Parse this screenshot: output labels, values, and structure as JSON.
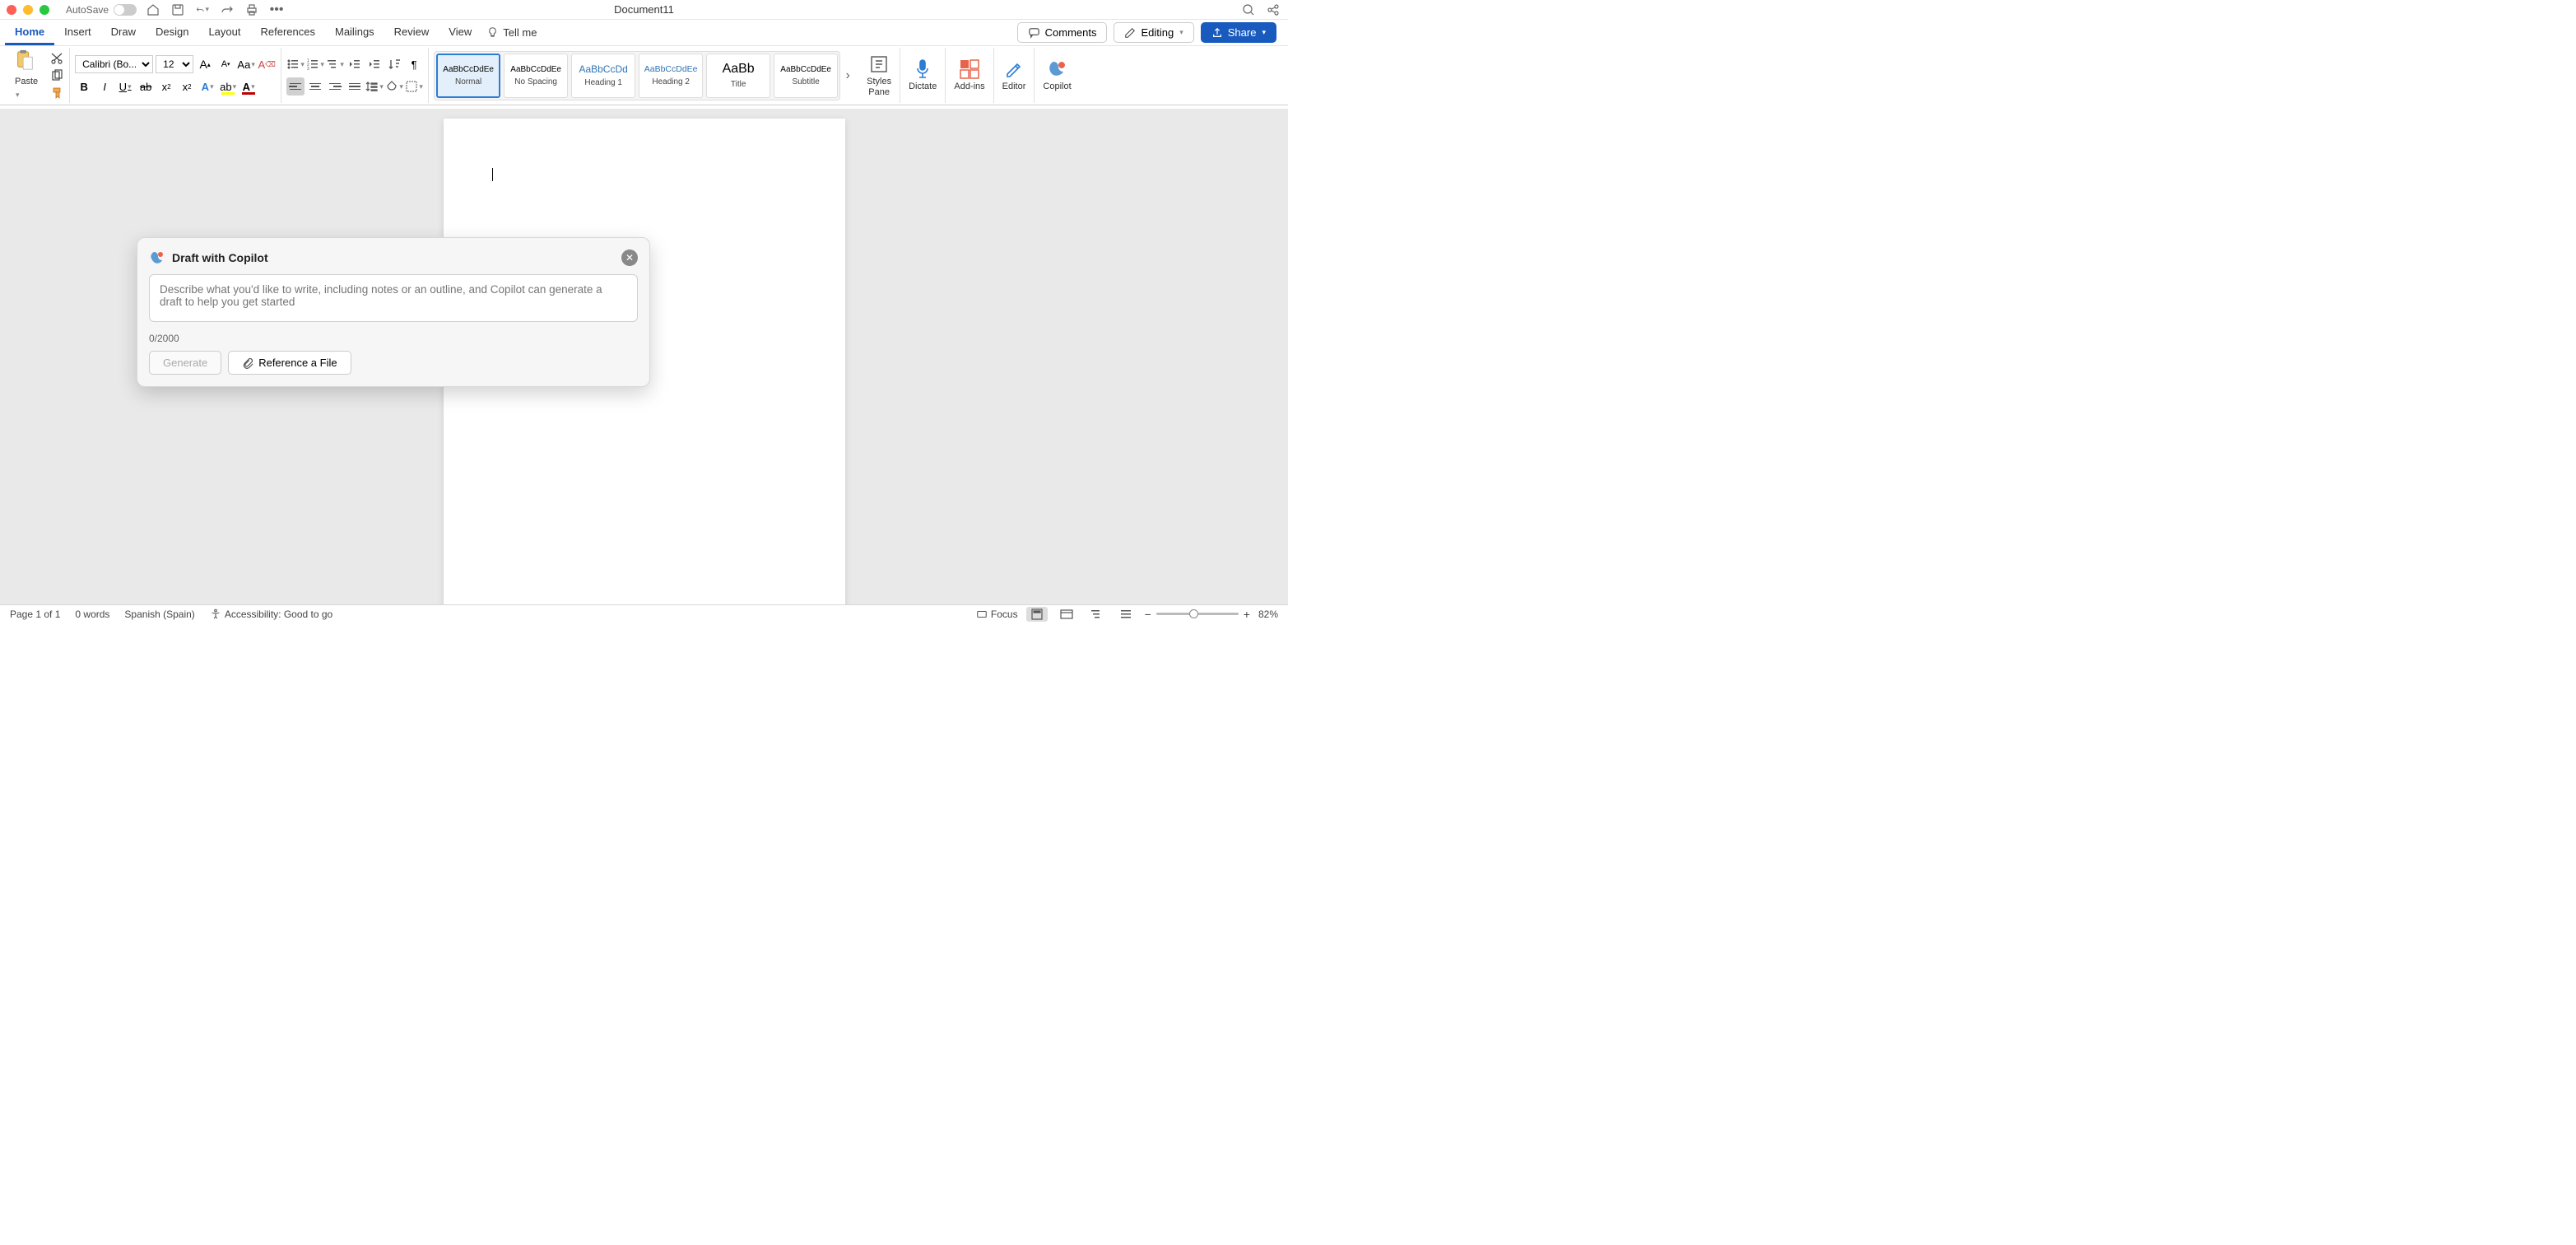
{
  "titlebar": {
    "autosave": "AutoSave",
    "document": "Document11"
  },
  "tabs": [
    "Home",
    "Insert",
    "Draw",
    "Design",
    "Layout",
    "References",
    "Mailings",
    "Review",
    "View"
  ],
  "tellme": "Tell me",
  "comments": "Comments",
  "editing": "Editing",
  "share": "Share",
  "paste": "Paste",
  "font": {
    "name": "Calibri (Bo...",
    "size": "12"
  },
  "styles": [
    {
      "preview": "AaBbCcDdEe",
      "label": "Normal",
      "cls": "",
      "sel": true
    },
    {
      "preview": "AaBbCcDdEe",
      "label": "No Spacing",
      "cls": "",
      "sel": false
    },
    {
      "preview": "AaBbCcDd",
      "label": "Heading 1",
      "cls": "h1",
      "sel": false
    },
    {
      "preview": "AaBbCcDdEe",
      "label": "Heading 2",
      "cls": "h2",
      "sel": false
    },
    {
      "preview": "AaBb",
      "label": "Title",
      "cls": "title",
      "sel": false
    },
    {
      "preview": "AaBbCcDdEe",
      "label": "Subtitle",
      "cls": "",
      "sel": false
    }
  ],
  "stylesPane": "Styles\nPane",
  "dictate": "Dictate",
  "addins": "Add-ins",
  "editor": "Editor",
  "copilotBtn": "Copilot",
  "copilot": {
    "title": "Draft with Copilot",
    "placeholder": "Describe what you'd like to write, including notes or an outline, and Copilot can generate a draft to help you get started",
    "count": "0/2000",
    "generate": "Generate",
    "reference": "Reference a File"
  },
  "status": {
    "page": "Page 1 of 1",
    "words": "0 words",
    "lang": "Spanish (Spain)",
    "a11y": "Accessibility: Good to go",
    "focus": "Focus",
    "zoom": "82%"
  }
}
